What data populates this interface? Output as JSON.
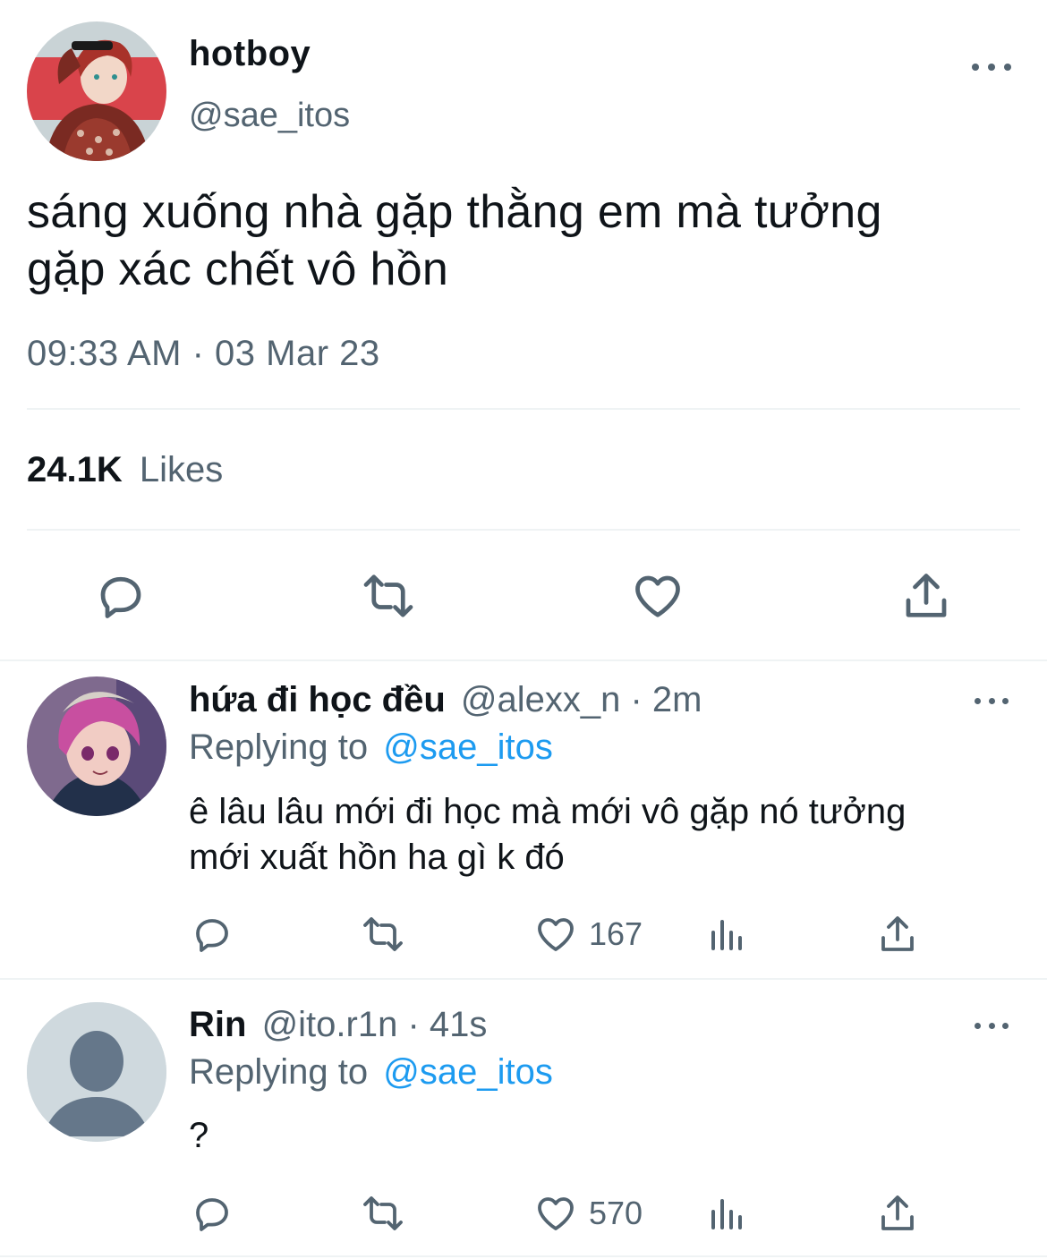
{
  "tweet": {
    "display_name": "hotboy",
    "handle": "@sae_itos",
    "text_line1": "sáng xuống nhà gặp thằng em mà tưởng",
    "text_line2": "gặp xác chết vô hồn",
    "timestamp": "09:33 AM · 03 Mar 23",
    "likes_count": "24.1K",
    "likes_label": "Likes"
  },
  "replies": [
    {
      "display_name": "hứa đi học đều",
      "meta": "@alexx_n · 2m",
      "replying_prefix": "Replying to",
      "replying_handle": "@sae_itos",
      "text_line1": "ê lâu lâu mới đi học mà mới vô gặp nó tưởng",
      "text_line2": "mới xuất hồn ha gì k đó",
      "like_count": "167"
    },
    {
      "display_name": "Rin",
      "meta": "@ito.r1n · 41s",
      "replying_prefix": "Replying to",
      "replying_handle": "@sae_itos",
      "text_line1": "?",
      "like_count": "570"
    }
  ],
  "icons": {
    "more": "more-horizontal-icon",
    "reply": "reply-bubble-icon",
    "retweet": "retweet-icon",
    "like": "heart-icon",
    "views": "analytics-bars-icon",
    "share": "share-upload-icon"
  },
  "colors": {
    "text": "#0f1419",
    "secondary": "#536471",
    "link": "#1d9bf0",
    "divider": "#eff3f4"
  }
}
